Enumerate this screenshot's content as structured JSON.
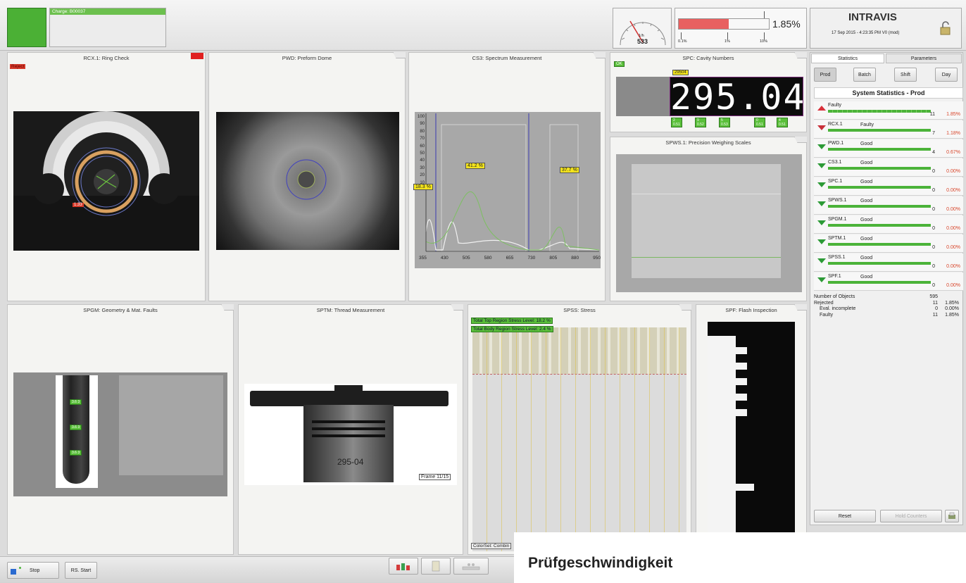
{
  "top": {
    "charge": "Charge: B00037",
    "gauge": {
      "unit": "1/h",
      "value": "533"
    },
    "reject_bar": {
      "percent": "1.85%",
      "ticks": [
        "0.1%",
        "1%",
        "10%"
      ],
      "fill_fraction": 0.2
    },
    "brand": {
      "name": "INTRAVIS",
      "timestamp": "17 Sep 2015 - 4:23:35 PM  V0 (mod)"
    }
  },
  "panels": {
    "rcx": {
      "title": "RCX.1: Ring Check",
      "badge": "Reject",
      "marker": "1.33"
    },
    "pwd": {
      "title": "PWD: Preform Dome"
    },
    "cs3": {
      "title": "CS3: Spectrum Measurement",
      "labels": [
        "18.3 %",
        "41.2 %",
        "37.7 %"
      ],
      "yticks": [
        "100",
        "90",
        "80",
        "70",
        "60",
        "50",
        "40",
        "30",
        "20",
        "10"
      ],
      "xticks": [
        "355",
        "430",
        "505",
        "580",
        "655",
        "730",
        "805",
        "880",
        "950"
      ]
    },
    "spc": {
      "title": "SPC: Cavity Numbers",
      "tag": "OK",
      "small_label": "29504",
      "number": "295.04",
      "digits": [
        "2\n0.51",
        "9\n0.52",
        "5\n0.53",
        "0\n0.51",
        "4\n0.51"
      ]
    },
    "spws": {
      "title": "SPWS.1: Precision Weighing Scales"
    },
    "spgm": {
      "title": "SPGM: Geometry & Mat. Faults",
      "labels": [
        "3.6 3",
        "3.6 3",
        "3.6 3"
      ]
    },
    "sptm": {
      "title": "SPTM: Thread Measurement",
      "cap_text": "295-04",
      "frame": "Frame 11/15"
    },
    "spss": {
      "title": "SPSS: Stress",
      "top_level": "Total Top Region Stress Level: 18.2 %",
      "body_level": "Total Body Region Stress Level: 2.4 %",
      "colorset": "ColorSet: Combin"
    },
    "spf": {
      "title": "SPF: Flash Inspection"
    }
  },
  "right": {
    "tabs": [
      "Statistics",
      "Parameters"
    ],
    "periods": [
      "Prod",
      "Batch",
      "Shift",
      "Day"
    ],
    "heading": "System Statistics - Prod",
    "rows": [
      {
        "name": "Faulty",
        "state": "",
        "count": "11",
        "pct": "1.85%",
        "dir": "up"
      },
      {
        "name": "RCX.1",
        "state": "Faulty",
        "count": "7",
        "pct": "1.18%",
        "dir": "down-red"
      },
      {
        "name": "PWD.1",
        "state": "Good",
        "count": "4",
        "pct": "0.67%",
        "dir": "down"
      },
      {
        "name": "CS3.1",
        "state": "Good",
        "count": "0",
        "pct": "0.00%",
        "dir": "down"
      },
      {
        "name": "SPC.1",
        "state": "Good",
        "count": "0",
        "pct": "0.00%",
        "dir": "down"
      },
      {
        "name": "SPWS.1",
        "state": "Good",
        "count": "0",
        "pct": "0.00%",
        "dir": "down"
      },
      {
        "name": "SPGM.1",
        "state": "Good",
        "count": "0",
        "pct": "0.00%",
        "dir": "down"
      },
      {
        "name": "SPTM.1",
        "state": "Good",
        "count": "0",
        "pct": "0.00%",
        "dir": "down"
      },
      {
        "name": "SPSS.1",
        "state": "Good",
        "count": "0",
        "pct": "0.00%",
        "dir": "down"
      },
      {
        "name": "SPF.1",
        "state": "Good",
        "count": "0",
        "pct": "0.00%",
        "dir": "down"
      }
    ],
    "summary": [
      {
        "label": "Number of Objects",
        "count": "595",
        "pct": ""
      },
      {
        "label": "Rejected",
        "count": "11",
        "pct": "1.85%"
      },
      {
        "label": "Eval. incomplete",
        "count": "0",
        "pct": "0.00%"
      },
      {
        "label": "Faulty",
        "count": "11",
        "pct": "1.85%"
      }
    ],
    "buttons": {
      "reset": "Reset",
      "hold": "Hold Counters"
    }
  },
  "bottom": {
    "stop": "Stop",
    "rs_start": "RS. Start"
  },
  "caption": "Prüfgeschwindigkeit"
}
